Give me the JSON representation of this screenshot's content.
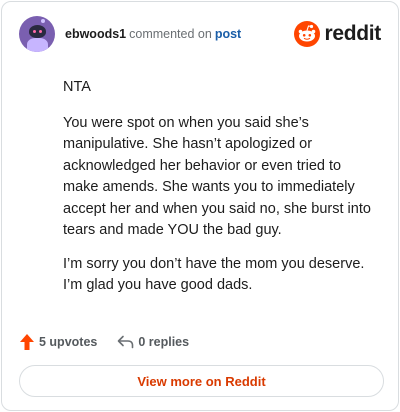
{
  "header": {
    "username": "ebwoods1",
    "commented_on": "commented on",
    "post_link": "post",
    "brand": "reddit"
  },
  "comment": {
    "paragraphs": [
      "NTA",
      "You were spot on when you said she’s manipulative. She hasn’t apologized or acknowledged her behavior or even tried to make amends. She wants you to immediately accept her and when you said no, she burst into tears and made YOU the bad guy.",
      "I’m sorry you don’t have the mom you deserve. I’m glad you have good dads."
    ]
  },
  "actions": {
    "upvotes": "5 upvotes",
    "replies": "0 replies"
  },
  "footer": {
    "view_more": "View more on Reddit"
  },
  "colors": {
    "reddit_orange": "#ff4500",
    "link_blue": "#1a5ea8",
    "view_more_text": "#d93a00"
  },
  "icons": {
    "avatar": "snoo-avatar",
    "brand": "reddit-snoo-icon",
    "upvote": "upvote-arrow-icon",
    "reply": "reply-arrow-icon"
  }
}
